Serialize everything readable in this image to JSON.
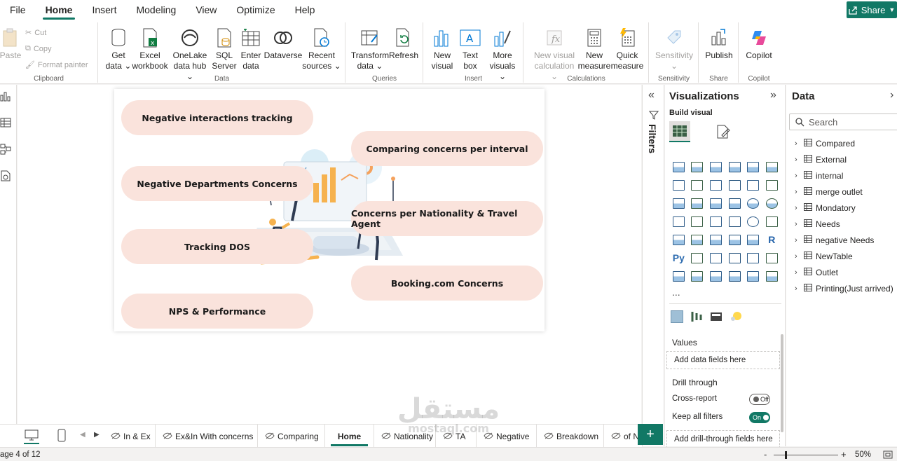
{
  "menu": {
    "items": [
      "File",
      "Home",
      "Insert",
      "Modeling",
      "View",
      "Optimize",
      "Help"
    ],
    "active": "Home",
    "share_label": "Share"
  },
  "ribbon": {
    "clipboard": {
      "paste": "Paste",
      "cut": "Cut",
      "copy": "Copy",
      "format_painter": "Format painter",
      "label": "Clipboard"
    },
    "data": {
      "get_data_1": "Get",
      "get_data_2": "data",
      "excel_1": "Excel",
      "excel_2": "workbook",
      "onelake_1": "OneLake",
      "onelake_2": "data hub",
      "sql_1": "SQL",
      "sql_2": "Server",
      "enter_1": "Enter",
      "enter_2": "data",
      "dataverse": "Dataverse",
      "recent_1": "Recent",
      "recent_2": "sources",
      "label": "Data"
    },
    "queries": {
      "transform_1": "Transform",
      "transform_2": "data",
      "refresh": "Refresh",
      "label": "Queries"
    },
    "insert": {
      "new_visual_1": "New",
      "new_visual_2": "visual",
      "text_box_1": "Text",
      "text_box_2": "box",
      "more_visuals_1": "More",
      "more_visuals_2": "visuals",
      "label": "Insert"
    },
    "calculations": {
      "new_visual_calc_1": "New visual",
      "new_visual_calc_2": "calculation",
      "new_measure_1": "New",
      "new_measure_2": "measure",
      "quick_measure_1": "Quick",
      "quick_measure_2": "measure",
      "label": "Calculations"
    },
    "sensitivity": {
      "btn": "Sensitivity",
      "label": "Sensitivity"
    },
    "share": {
      "publish": "Publish",
      "label": "Share"
    },
    "copilot": {
      "btn": "Copilot",
      "label": "Copilot"
    }
  },
  "canvas": {
    "pills": [
      "Negative interactions tracking",
      "Comparing concerns per interval",
      "Negative Departments Concerns",
      "Concerns per Nationality & Travel Agent",
      "Tracking DOS",
      "Booking.com Concerns",
      "NPS & Performance"
    ]
  },
  "filters": {
    "label": "Filters"
  },
  "visualizations": {
    "title": "Visualizations",
    "build_visual": "Build visual",
    "more": "...",
    "values_label": "Values",
    "values_placeholder": "Add data fields here",
    "drill_through": "Drill through",
    "cross_report": "Cross-report",
    "cross_report_state": "Off",
    "keep_all_filters": "Keep all filters",
    "keep_all_filters_state": "On",
    "drill_placeholder": "Add drill-through fields here",
    "py_label": "Py",
    "r_label": "R"
  },
  "data_pane": {
    "title": "Data",
    "search_placeholder": "Search",
    "tables": [
      "Compared",
      "External",
      "internal",
      "merge outlet",
      "Mondatory",
      "Needs",
      "negative Needs",
      "NewTable",
      "Outlet",
      "Printing(Just arrived)"
    ]
  },
  "page_tabs": {
    "tabs": [
      "In & Ex",
      "Ex&In With concerns",
      "Comparing",
      "Home",
      "Nationality",
      "TA",
      "Negative",
      "Breakdown",
      "of N"
    ],
    "active": "Home",
    "add_label": "+"
  },
  "status": {
    "page_info": "age 4 of 12",
    "zoom": "50%",
    "zoom_minus": "-",
    "zoom_plus": "+"
  },
  "watermark": {
    "line1": "مستقل",
    "line2": "mostaql.com"
  },
  "colors": {
    "accent": "#117865",
    "pill": "#fae3dc"
  }
}
